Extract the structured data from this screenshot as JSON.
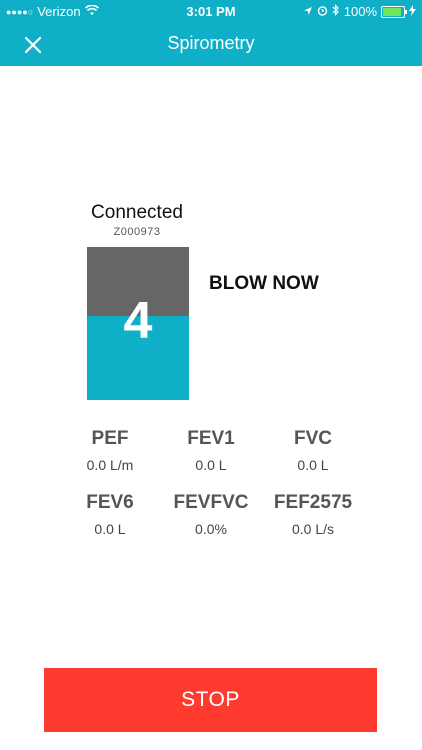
{
  "status_bar": {
    "carrier": "Verizon",
    "time": "3:01 PM",
    "battery": "100%",
    "battery_level": 1.0
  },
  "nav": {
    "title": "Spirometry",
    "close_icon": "close-icon"
  },
  "device": {
    "status": "Connected",
    "serial": "Z000973"
  },
  "meter": {
    "value": "4",
    "fill_fraction": 0.55,
    "instruction": "BLOW NOW",
    "colors": {
      "empty": "#666666",
      "filled": "#10AFC8"
    }
  },
  "metrics": [
    {
      "label": "PEF",
      "value": "0.0 L/m"
    },
    {
      "label": "FEV1",
      "value": "0.0 L"
    },
    {
      "label": "FVC",
      "value": "0.0 L"
    },
    {
      "label": "FEV6",
      "value": "0.0 L"
    },
    {
      "label": "FEVFVC",
      "value": "0.0%"
    },
    {
      "label": "FEF2575",
      "value": "0.0 L/s"
    }
  ],
  "stop_button": {
    "label": "STOP",
    "color": "#FF3B30"
  },
  "colors": {
    "accent": "#10AFC8"
  }
}
